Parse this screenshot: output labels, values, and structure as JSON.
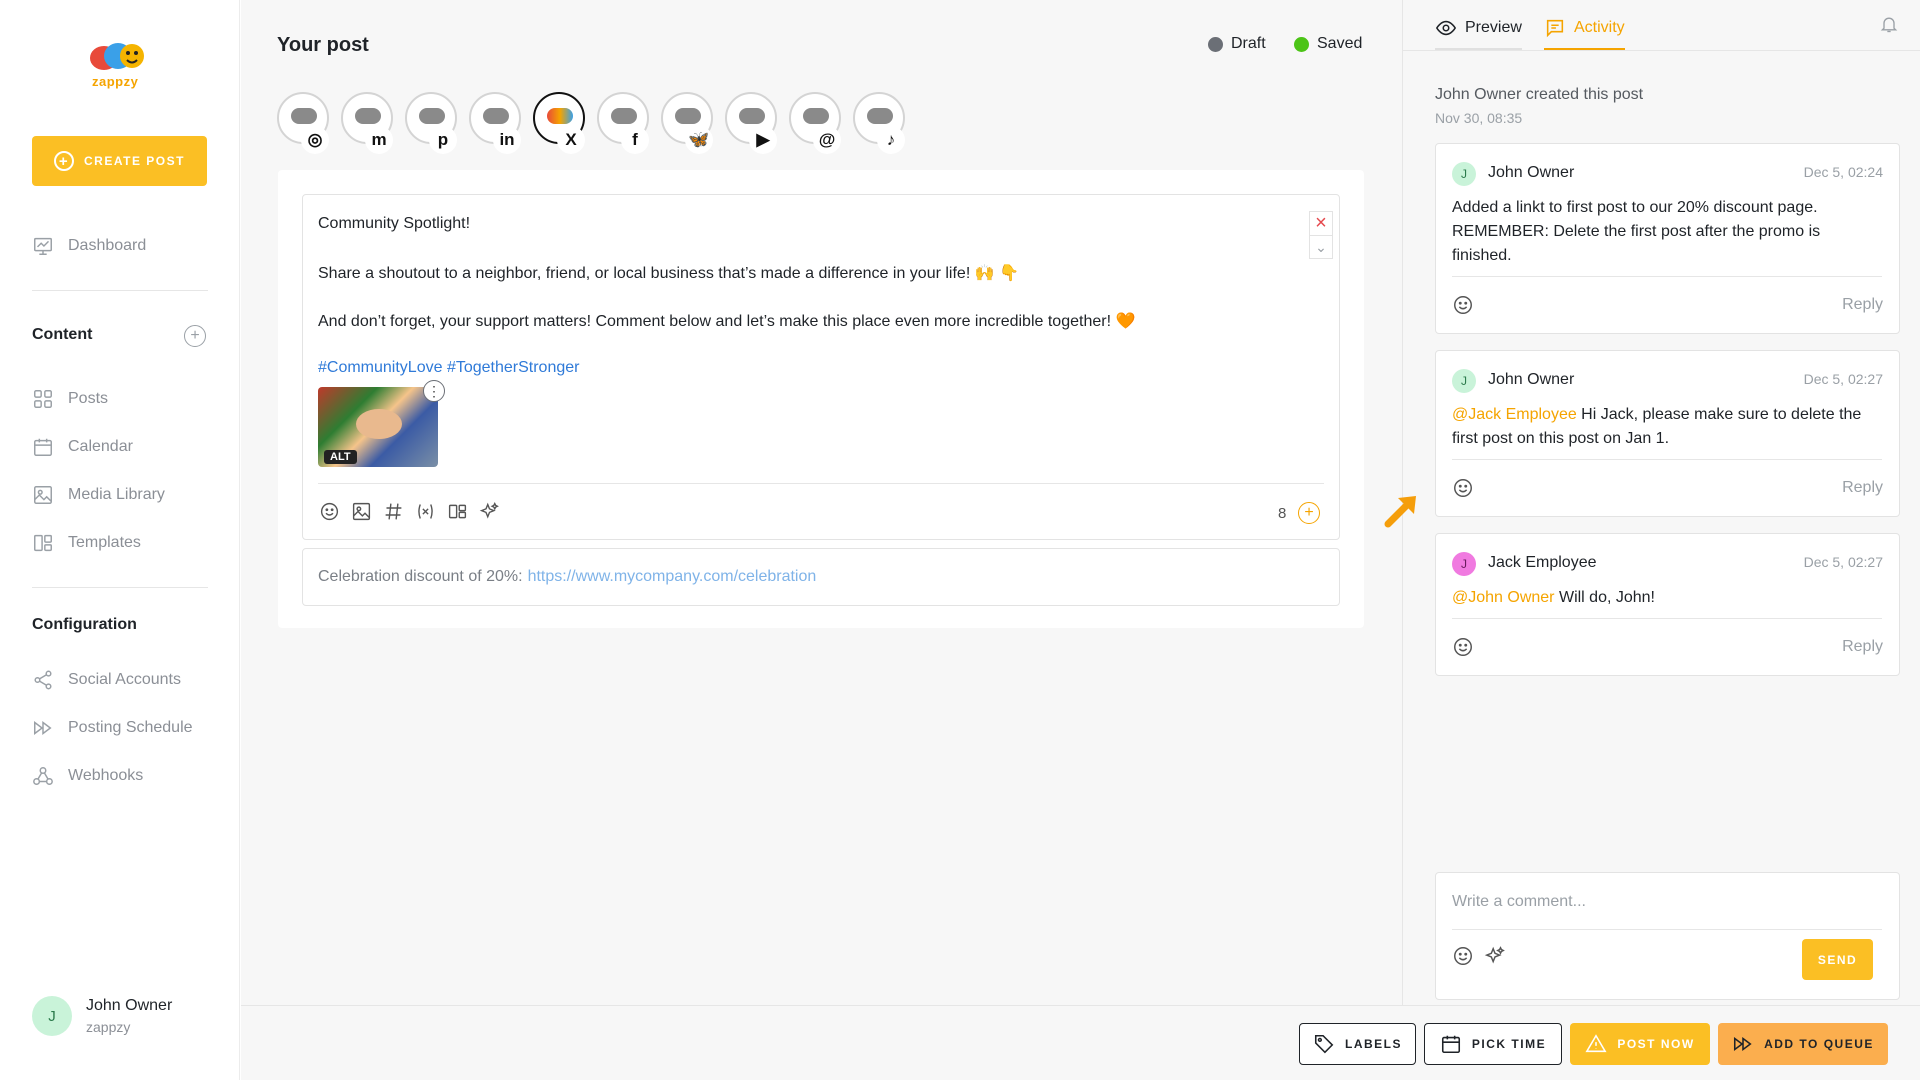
{
  "brand": {
    "logo_text": "zappzy",
    "accent": "#fbbf24",
    "link": "#2f7ad8"
  },
  "sidebar": {
    "create_post": "CREATE POST",
    "dashboard": "Dashboard",
    "content_heading": "Content",
    "content_items": [
      "Posts",
      "Calendar",
      "Media Library",
      "Templates"
    ],
    "config_heading": "Configuration",
    "config_items": [
      "Social Accounts",
      "Posting Schedule",
      "Webhooks"
    ],
    "user": {
      "initial": "J",
      "name": "John Owner",
      "org": "zappzy"
    }
  },
  "post": {
    "title": "Your post",
    "status_draft": "Draft",
    "status_saved": "Saved",
    "draft_color": "#6b6f76",
    "saved_color": "#4cc417",
    "channels": [
      {
        "network": "instagram",
        "glyph": "◎",
        "active": false
      },
      {
        "network": "mastodon",
        "glyph": "m",
        "active": false
      },
      {
        "network": "pinterest",
        "glyph": "p",
        "active": false
      },
      {
        "network": "linkedin",
        "glyph": "in",
        "active": false
      },
      {
        "network": "x",
        "glyph": "X",
        "active": true
      },
      {
        "network": "facebook",
        "glyph": "f",
        "active": false
      },
      {
        "network": "bluesky",
        "glyph": "🦋",
        "active": false
      },
      {
        "network": "youtube",
        "glyph": "▶",
        "active": false
      },
      {
        "network": "threads",
        "glyph": "@",
        "active": false
      },
      {
        "network": "tiktok",
        "glyph": "♪",
        "active": false
      }
    ],
    "lines": {
      "l1": "Community Spotlight!",
      "l2": "Share a shoutout to a neighbor, friend, or local business that’s made a difference in your life! 🙌 👇",
      "l3": "And don’t forget, your support matters! Comment below and let’s make this place even more incredible together! 🧡",
      "hashtags": "#CommunityLove #TogetherStronger"
    },
    "image_alt_badge": "ALT",
    "char_count": "8",
    "first_comment_label": "Celebration discount of 20%:",
    "first_comment_link": "https://www.mycompany.com/celebration"
  },
  "panel": {
    "tab_preview": "Preview",
    "tab_activity": "Activity",
    "created_text": "John Owner created this post",
    "created_date": "Nov 30, 08:35",
    "comments": [
      {
        "initial": "J",
        "author": "John Owner",
        "date": "Dec 5, 02:24",
        "mention": "",
        "text": "Added a linkt to first post to our 20% discount page. REMEMBER: Delete the first post after the promo is finished.",
        "reply": "Reply",
        "avatar_bg": "#c9f3d9",
        "avatar_fg": "#2b7a4b"
      },
      {
        "initial": "J",
        "author": "John Owner",
        "date": "Dec 5, 02:27",
        "mention": "@Jack Employee",
        "text": " Hi Jack, please make sure to delete the first post on this post on Jan 1.",
        "reply": "Reply",
        "avatar_bg": "#c9f3d9",
        "avatar_fg": "#2b7a4b"
      },
      {
        "initial": "J",
        "author": "Jack Employee",
        "date": "Dec 5, 02:27",
        "mention": "@John Owner",
        "text": " Will do, John!",
        "reply": "Reply",
        "avatar_bg": "#f07ae0",
        "avatar_fg": "#6a1a5e"
      }
    ],
    "comment_placeholder": "Write a comment...",
    "send": "SEND"
  },
  "footer": {
    "labels": "LABELS",
    "pick_time": "PICK TIME",
    "post_now": "POST NOW",
    "add_to_queue": "ADD TO QUEUE"
  }
}
